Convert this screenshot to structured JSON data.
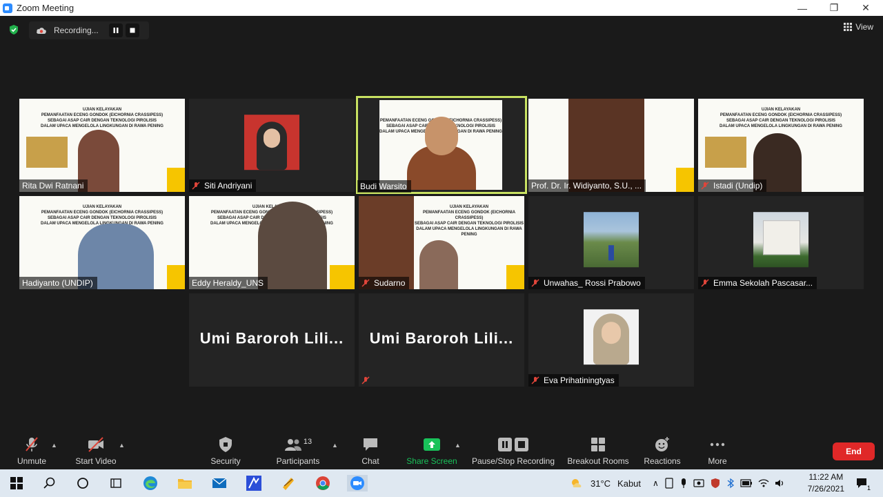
{
  "window": {
    "title": "Zoom Meeting",
    "minimize": "—",
    "restore": "❐",
    "close": "✕"
  },
  "recording": {
    "label": "Recording..."
  },
  "view": {
    "label": "View"
  },
  "slide": {
    "line1": "UJIAN KELAYAKAN",
    "line2": "PEMANFAATAN ECENG GONDOK (EICHORNIA CRASSIPESS)",
    "line3": "SEBAGAI ASAP CAIR DENGAN TEKNOLOGI PIROLISIS",
    "line4": "DALAM UPACA MENGELOLA LINGKUNGAN DI RAWA PENING",
    "presenter": "Rita Dwi Ratnani"
  },
  "participants": [
    {
      "name": "Rita Dwi Ratnani",
      "muted": false
    },
    {
      "name": "Siti Andriyani",
      "muted": true
    },
    {
      "name": "Budi Warsito",
      "muted": false
    },
    {
      "name": "Prof. Dr. Ir. Widiyanto, S.U., ...",
      "muted": false
    },
    {
      "name": "Istadi (Undip)",
      "muted": true
    },
    {
      "name": "Hadiyanto (UNDIP)",
      "muted": false
    },
    {
      "name": "Eddy Heraldy_UNS",
      "muted": false
    },
    {
      "name": "Sudarno",
      "muted": true
    },
    {
      "name": "Unwahas_ Rossi Prabowo",
      "muted": true
    },
    {
      "name": "Emma Sekolah Pascasar...",
      "muted": true
    },
    {
      "name": "Umi Baroroh Lili...",
      "muted": false
    },
    {
      "name": "Umi Baroroh Lili...",
      "muted": true
    },
    {
      "name": "Eva Prihatiningtyas",
      "muted": true
    }
  ],
  "toolbar": {
    "unmute": "Unmute",
    "start_video": "Start Video",
    "security": "Security",
    "participants": "Participants",
    "participants_count": "13",
    "chat": "Chat",
    "share_screen": "Share Screen",
    "pause_stop": "Pause/Stop Recording",
    "breakout": "Breakout Rooms",
    "reactions": "Reactions",
    "more": "More",
    "end": "End"
  },
  "taskbar": {
    "weather_temp": "31°C",
    "weather_desc": "Kabut",
    "time": "11:22 AM",
    "date": "7/26/2021",
    "notif_count": "1"
  },
  "colors": {
    "active_border": "#c9e262",
    "share_green": "#19c25a",
    "end_red": "#e02828",
    "muted_red": "#e0453a"
  }
}
